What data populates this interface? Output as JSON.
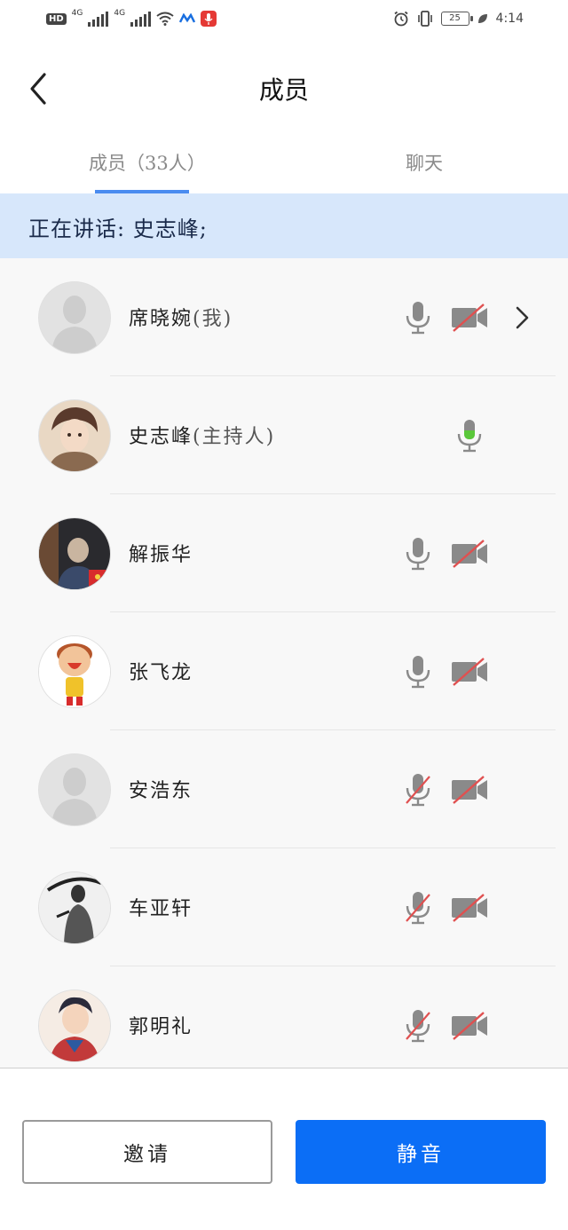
{
  "status_bar": {
    "network_labels": [
      "HD",
      "4G",
      "4G"
    ],
    "battery": "25",
    "time": "4:14"
  },
  "header": {
    "title": "成员"
  },
  "tabs": [
    {
      "label": "成员（33人）",
      "active": true
    },
    {
      "label": "聊天",
      "active": false
    }
  ],
  "speaking_bar": {
    "text": "正在讲话: 史志峰;"
  },
  "members": [
    {
      "name": "席晓婉",
      "suffix": "(我)",
      "mic": "available",
      "camera": "off",
      "chevron": true,
      "avatar": "placeholder-avatar"
    },
    {
      "name": "史志峰",
      "suffix": "(主持人)",
      "mic": "speaking",
      "camera": "none",
      "chevron": false,
      "avatar": "anime-boy-avatar"
    },
    {
      "name": "解振华",
      "suffix": "",
      "mic": "available",
      "camera": "off",
      "chevron": false,
      "avatar": "dark-photo-avatar"
    },
    {
      "name": "张飞龙",
      "suffix": "",
      "mic": "available",
      "camera": "off",
      "chevron": false,
      "avatar": "cartoon-kid-avatar"
    },
    {
      "name": "安浩东",
      "suffix": "",
      "mic": "muted",
      "camera": "off",
      "chevron": false,
      "avatar": "placeholder-avatar"
    },
    {
      "name": "车亚轩",
      "suffix": "",
      "mic": "muted",
      "camera": "off",
      "chevron": false,
      "avatar": "ink-warrior-avatar"
    },
    {
      "name": "郭明礼",
      "suffix": "",
      "mic": "muted",
      "camera": "off",
      "chevron": false,
      "avatar": "illustrated-man-avatar"
    }
  ],
  "footer": {
    "invite_label": "邀请",
    "mute_label": "静音"
  },
  "colors": {
    "accent": "#0b6ef6",
    "speaking_bg": "#d7e7fb",
    "mic_active": "#5ac83a",
    "disabled_slash": "#e05050",
    "icon_gray": "#8a8a8a"
  }
}
